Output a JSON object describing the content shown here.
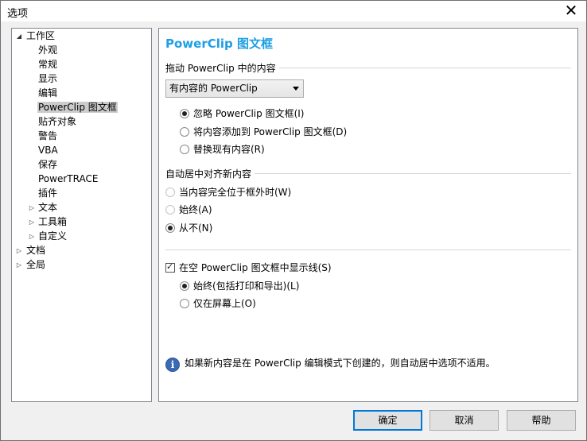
{
  "window": {
    "title": "选项"
  },
  "tree": {
    "items": [
      {
        "label": "工作区",
        "twisty": "◢"
      },
      {
        "label": "外观"
      },
      {
        "label": "常规"
      },
      {
        "label": "显示"
      },
      {
        "label": "编辑"
      },
      {
        "label": "PowerClip 图文框",
        "selected": true
      },
      {
        "label": "贴齐对象"
      },
      {
        "label": "警告"
      },
      {
        "label": "VBA"
      },
      {
        "label": "保存"
      },
      {
        "label": "PowerTRACE"
      },
      {
        "label": "插件"
      },
      {
        "label": "文本",
        "twisty": "▷"
      },
      {
        "label": "工具箱",
        "twisty": "▷"
      },
      {
        "label": "自定义",
        "twisty": "▷"
      },
      {
        "label": "文档",
        "twisty": "▷"
      },
      {
        "label": "全局",
        "twisty": "▷"
      }
    ]
  },
  "content": {
    "heading": "PowerClip 图文框",
    "drag_group": {
      "label": "拖动 PowerClip 中的内容",
      "dropdown_value": "有内容的 PowerClip",
      "options": [
        {
          "label": "忽略 PowerClip 图文框(I)",
          "checked": true
        },
        {
          "label": "将内容添加到 PowerClip 图文框(D)",
          "checked": false
        },
        {
          "label": "替换现有内容(R)",
          "checked": false
        }
      ]
    },
    "center_group": {
      "label": "自动居中对齐新内容",
      "options": [
        {
          "label": "当内容完全位于框外时(W)",
          "checked": false
        },
        {
          "label": "始终(A)",
          "checked": false
        },
        {
          "label": "从不(N)",
          "checked": true
        }
      ]
    },
    "show_lines": {
      "label": "在空 PowerClip 图文框中显示线(S)",
      "checked": true,
      "options": [
        {
          "label": "始终(包括打印和导出)(L)",
          "checked": true
        },
        {
          "label": "仅在屏幕上(O)",
          "checked": false
        }
      ]
    },
    "info_icon": "i",
    "info_text": "如果新内容是在 PowerClip 编辑模式下创建的，则自动居中选项不适用。"
  },
  "buttons": {
    "ok": "确定",
    "cancel": "取消",
    "help": "帮助"
  },
  "close_glyph": "✕",
  "colors": {
    "heading": "#1c9fe5",
    "selection": "#cccccc",
    "info": "#3a6ab4"
  }
}
